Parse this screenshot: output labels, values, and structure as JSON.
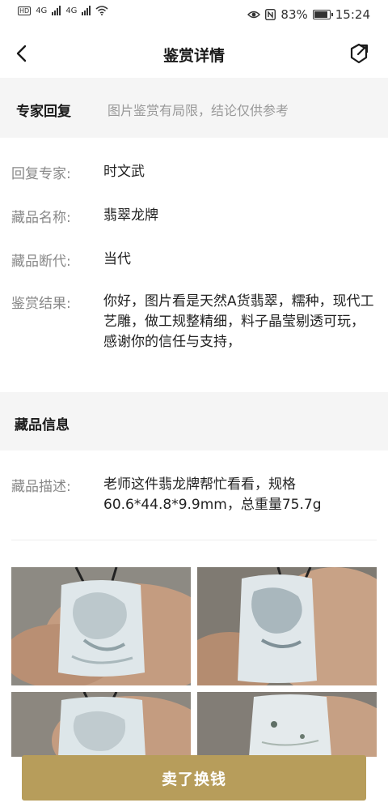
{
  "status_bar": {
    "network_left": "4G",
    "network_right": "4G",
    "battery": "83%",
    "time": "15:24"
  },
  "nav": {
    "title": "鉴赏详情"
  },
  "expert_section": {
    "title": "专家回复",
    "note": "图片鉴赏有局限，结论仅供参考"
  },
  "details": [
    {
      "label": "回复专家:",
      "value": "时文武"
    },
    {
      "label": "藏品名称:",
      "value": "翡翠龙牌"
    },
    {
      "label": "藏品断代:",
      "value": "当代"
    },
    {
      "label": "鉴赏结果:",
      "value": "你好，图片看是天然A货翡翠，糯种，现代工艺雕，做工规整精细，料子晶莹剔透可玩，感谢你的信任与支持，"
    }
  ],
  "info_section": {
    "title": "藏品信息",
    "desc_label": "藏品描述:",
    "desc_value": "老师这件翡龙牌帮忙看看，规格60.6*44.8*9.9mm，总重量75.7g"
  },
  "photos": [
    {
      "name": "jade-photo-1"
    },
    {
      "name": "jade-photo-2"
    },
    {
      "name": "jade-photo-3"
    },
    {
      "name": "jade-photo-4"
    }
  ],
  "footer": {
    "sell_label": "卖了换钱"
  },
  "colors": {
    "accent": "#b79d5b",
    "section_bg": "#f5f5f5",
    "label": "#888888"
  }
}
